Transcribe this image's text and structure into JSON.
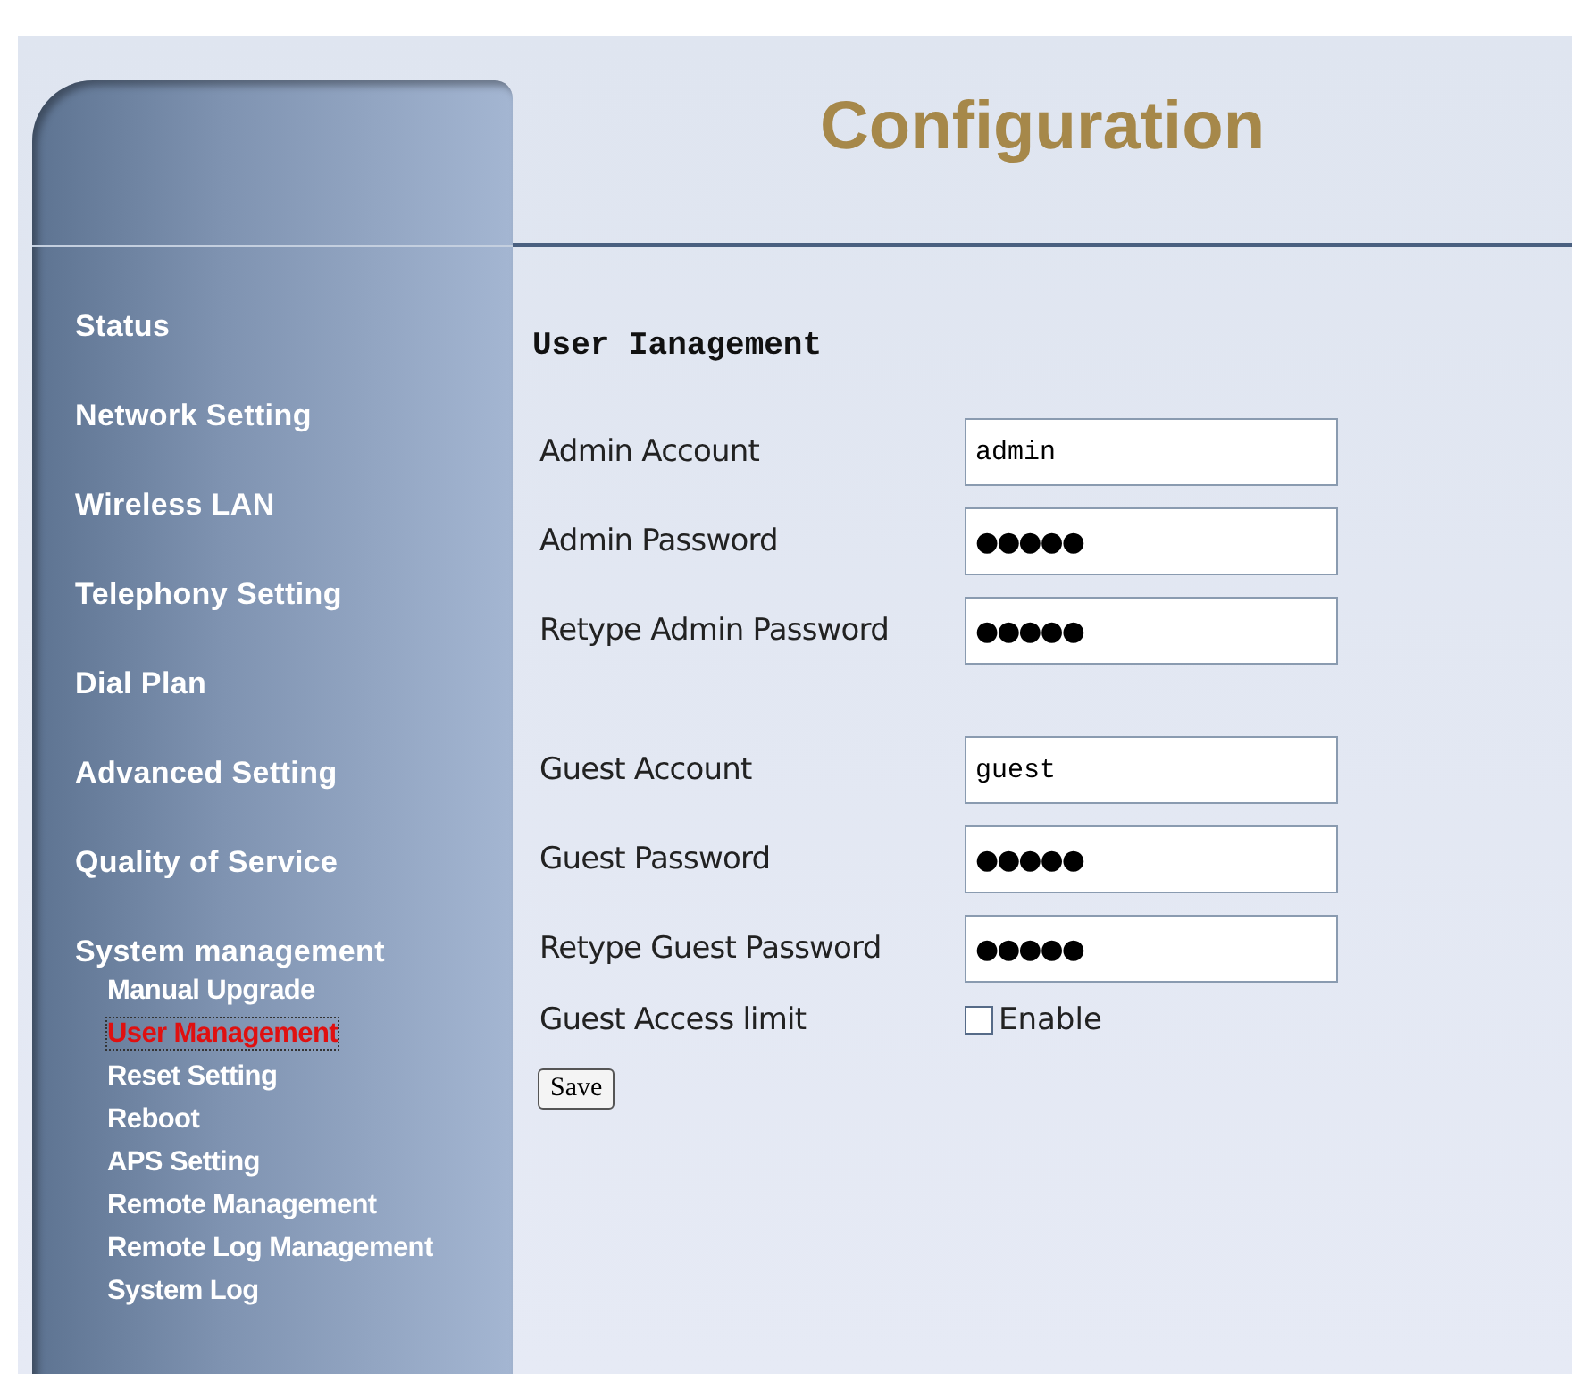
{
  "header": {
    "title": "Configuration"
  },
  "sidebar": {
    "items": [
      {
        "label": "Status",
        "selected": false
      },
      {
        "label": "Network Setting",
        "selected": false
      },
      {
        "label": "Wireless LAN",
        "selected": false
      },
      {
        "label": "Telephony Setting",
        "selected": false
      },
      {
        "label": "Dial Plan",
        "selected": false
      },
      {
        "label": "Advanced Setting",
        "selected": false
      },
      {
        "label": "Quality of Service",
        "selected": false
      },
      {
        "label": "System management",
        "selected": false,
        "children": [
          {
            "label": "Manual Upgrade",
            "selected": false
          },
          {
            "label": "User Management",
            "selected": true
          },
          {
            "label": "Reset Setting",
            "selected": false
          },
          {
            "label": "Reboot",
            "selected": false
          },
          {
            "label": "APS Setting",
            "selected": false
          },
          {
            "label": "Remote Management",
            "selected": false
          },
          {
            "label": "Remote Log Management",
            "selected": false
          },
          {
            "label": "System Log",
            "selected": false
          }
        ]
      }
    ]
  },
  "form": {
    "heading": "User Ianagement",
    "groups": [
      [
        {
          "label": "Admin Account",
          "value": "admin",
          "kind": "text"
        },
        {
          "label": "Admin Password",
          "value": "●●●●●",
          "kind": "password"
        },
        {
          "label": "Retype Admin Password",
          "value": "●●●●●",
          "kind": "password"
        }
      ],
      [
        {
          "label": "Guest Account",
          "value": "guest",
          "kind": "text"
        },
        {
          "label": "Guest Password",
          "value": "●●●●●",
          "kind": "password"
        },
        {
          "label": "Retype Guest Password",
          "value": "●●●●●",
          "kind": "password"
        }
      ]
    ],
    "access_limit": {
      "label": "Guest Access limit",
      "option": "Enable",
      "checked": false
    },
    "save_button": "Save"
  }
}
